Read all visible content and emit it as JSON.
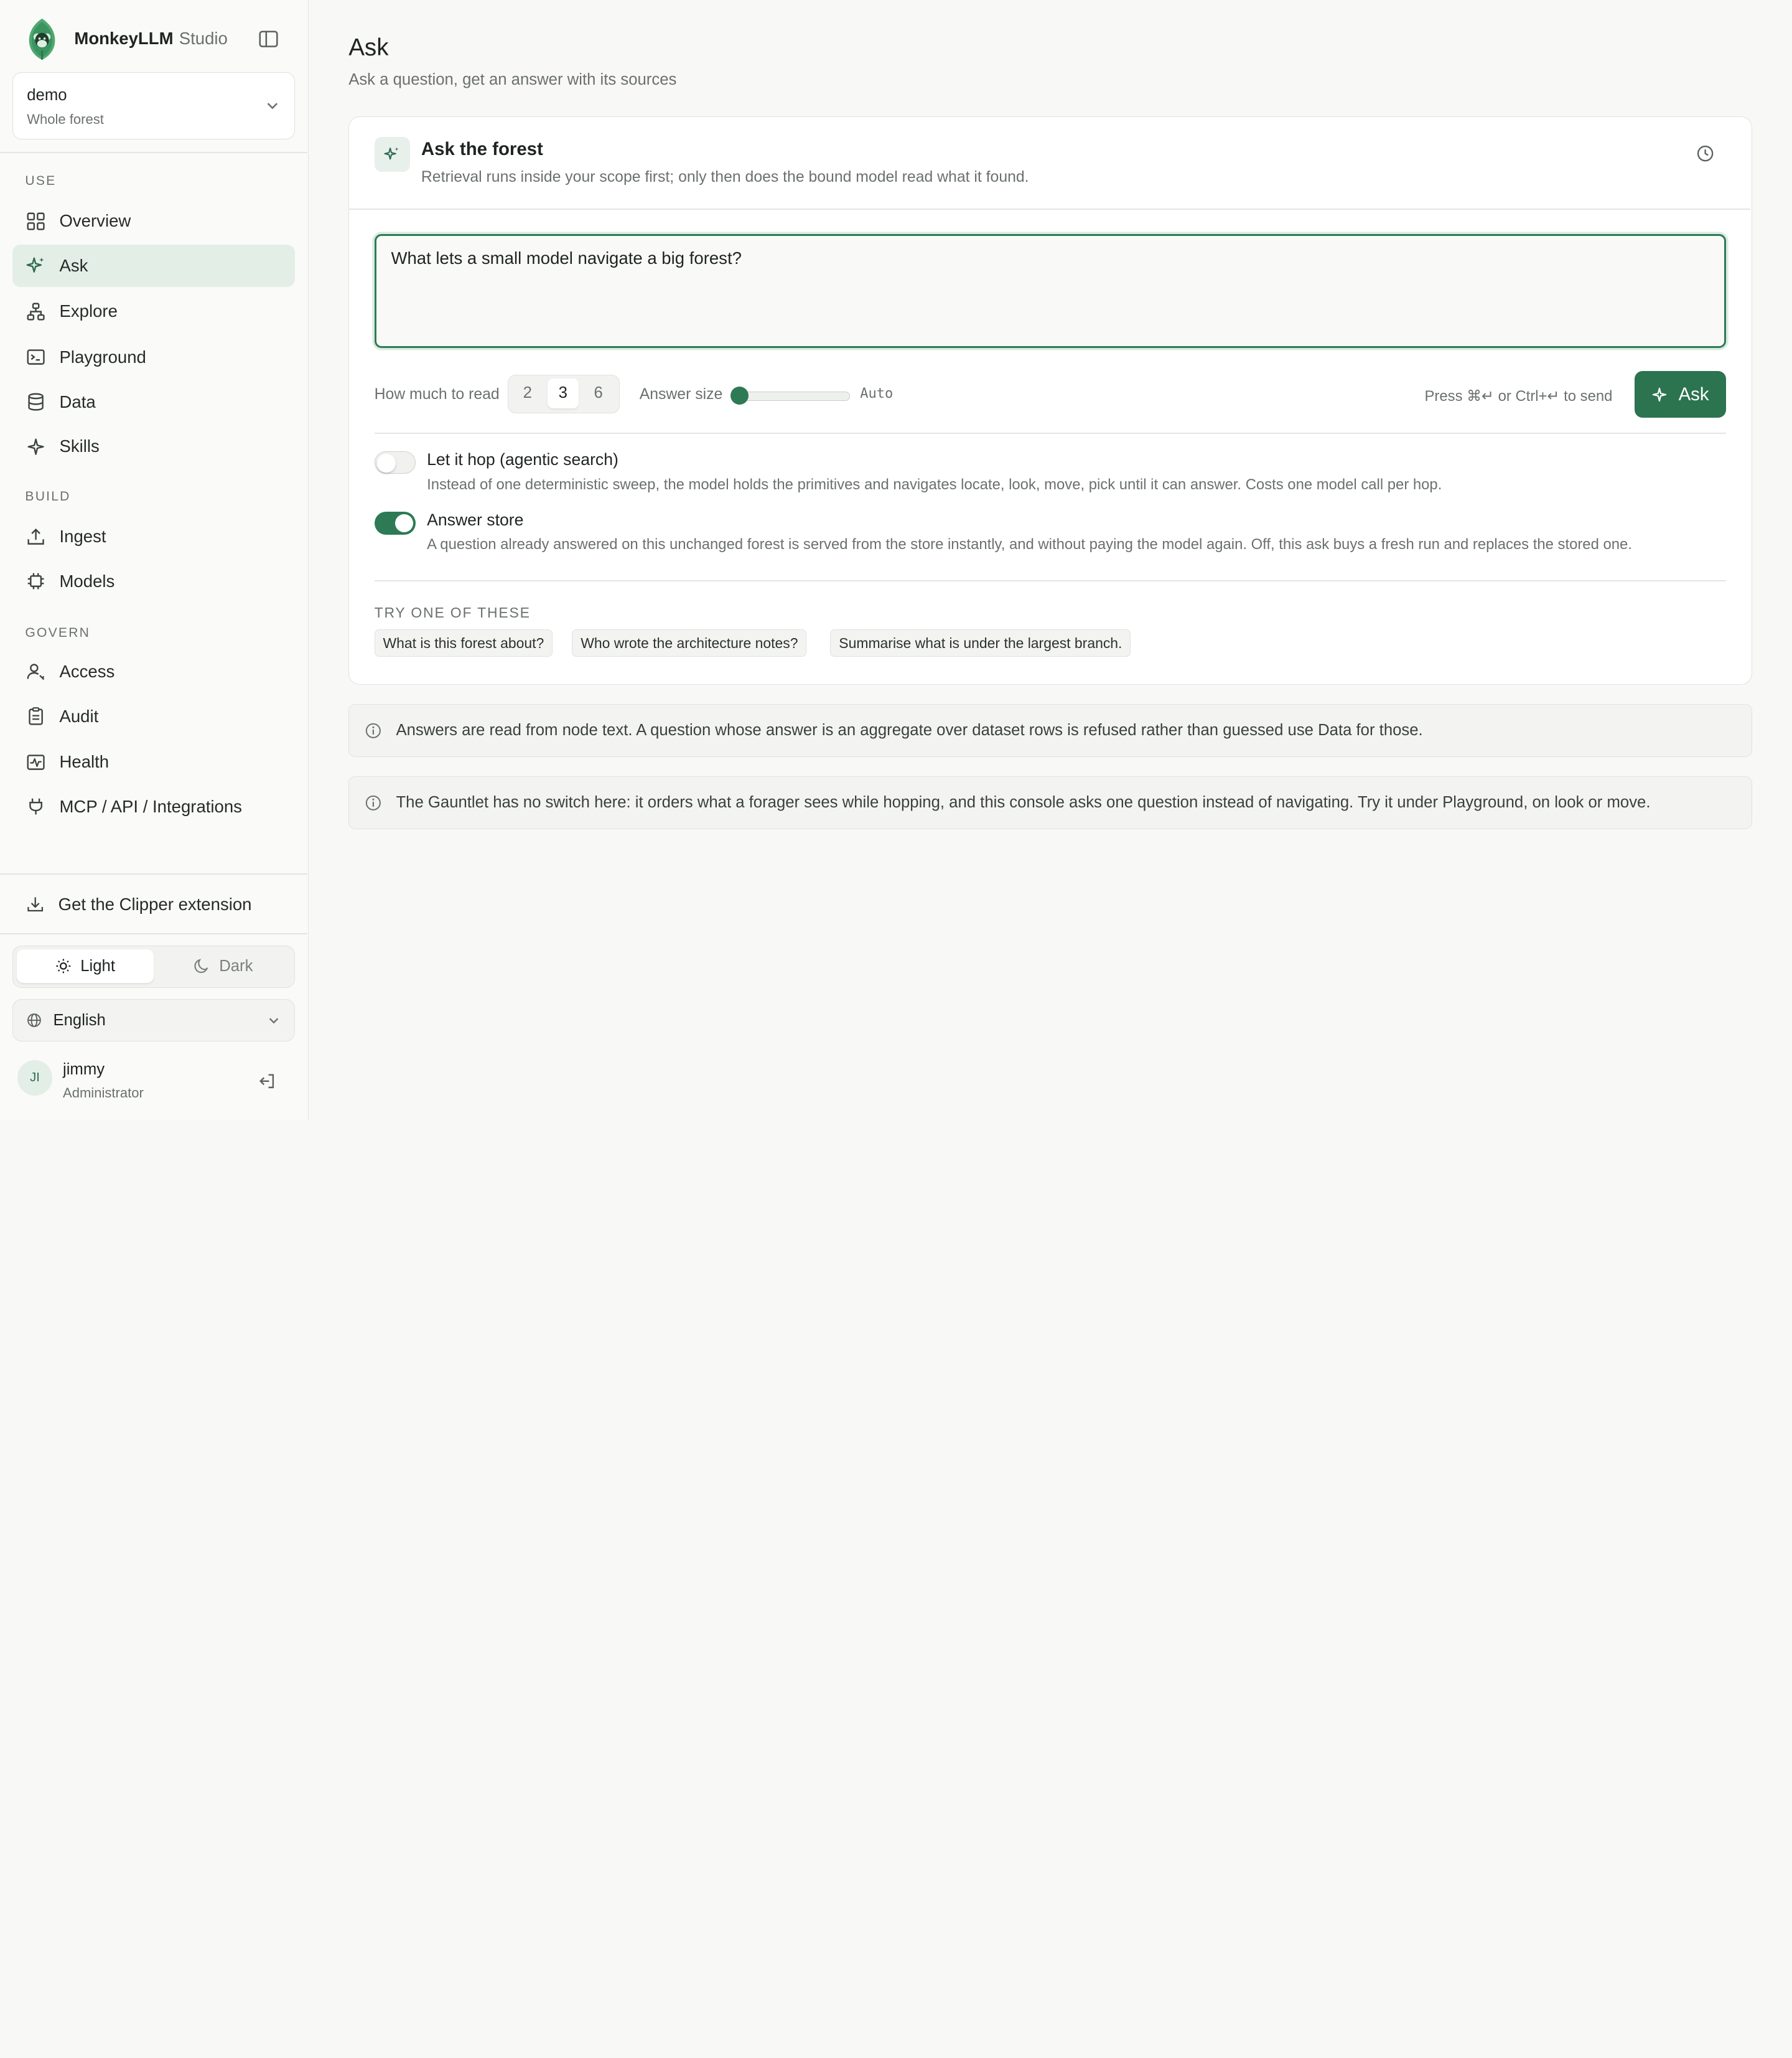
{
  "brand": {
    "name": "MonkeyLLM",
    "sub": "Studio"
  },
  "scope": {
    "name": "demo",
    "sub": "Whole forest"
  },
  "sections": {
    "use": "USE",
    "build": "BUILD",
    "govern": "GOVERN"
  },
  "nav": {
    "overview": "Overview",
    "ask": "Ask",
    "explore": "Explore",
    "playground": "Playground",
    "data": "Data",
    "skills": "Skills",
    "ingest": "Ingest",
    "models": "Models",
    "access": "Access",
    "audit": "Audit",
    "health": "Health",
    "integrations": "MCP / API / Integrations"
  },
  "clipper": "Get the Clipper extension",
  "theme": {
    "light": "Light",
    "dark": "Dark",
    "selected": "Light"
  },
  "language": "English",
  "user": {
    "initials": "JI",
    "name": "jimmy",
    "role": "Administrator"
  },
  "page": {
    "title": "Ask",
    "subtitle": "Ask a question, get an answer with its sources"
  },
  "card": {
    "title": "Ask the forest",
    "description": "Retrieval runs inside your scope first; only then does the bound model read what it found.",
    "question": "What lets a small model navigate a big forest?"
  },
  "controls": {
    "read_label": "How much to read",
    "read_options": [
      "2",
      "3",
      "6"
    ],
    "read_selected": "3",
    "answer_size_label": "Answer size",
    "answer_size_value": "Auto",
    "answer_size_level": 0,
    "hint": "Press ⌘↵ or Ctrl+↵ to send",
    "ask_label": "Ask"
  },
  "options": {
    "hop": {
      "title": "Let it hop (agentic search)",
      "description": "Instead of one deterministic sweep, the model holds the primitives and navigates locate, look, move, pick until it can answer. Costs one model call per hop.",
      "enabled": false
    },
    "store": {
      "title": "Answer store",
      "description": "A question already answered on this unchanged forest is served from the store instantly, and without paying the model again. Off, this ask buys a fresh run and replaces the stored one.",
      "enabled": true
    }
  },
  "suggestions": {
    "label": "TRY ONE OF THESE",
    "items": [
      "What is this forest about?",
      "Who wrote the architecture notes?",
      "Summarise what is under the largest branch."
    ]
  },
  "notes": [
    "Answers are read from node text. A question whose answer is an aggregate over dataset rows is refused rather than guessed use Data for those.",
    "The Gauntlet has no switch here: it orders what a forager sees while hopping, and this console asks one question instead of navigating. Try it under Playground, on look or move."
  ],
  "colors": {
    "accent": "#2e7a55",
    "active_bg": "#e3eee7"
  }
}
